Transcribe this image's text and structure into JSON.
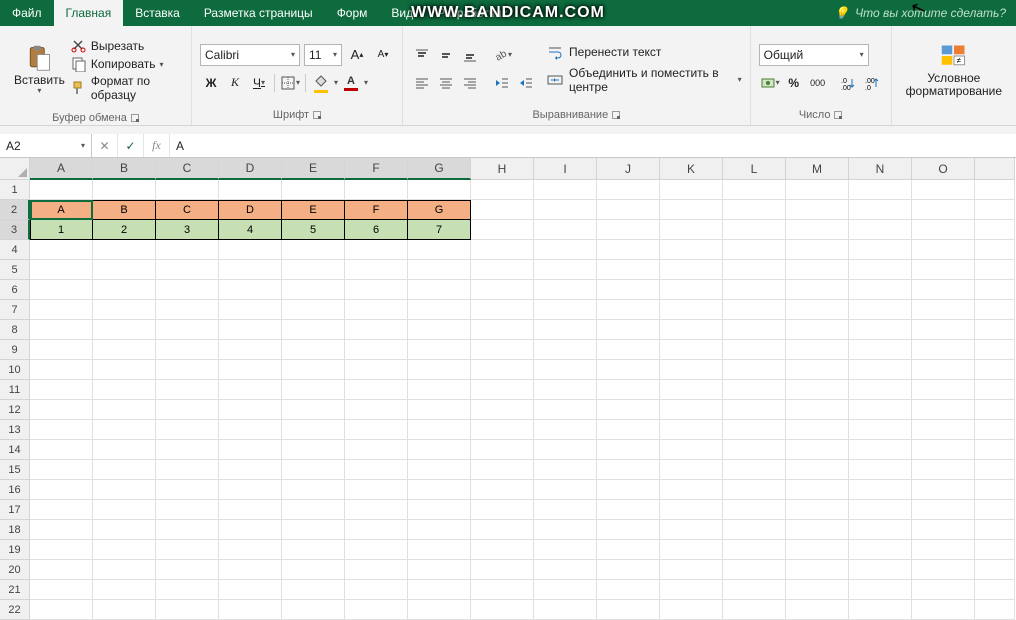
{
  "watermark": "WWW.BANDICAM.COM",
  "tabs": {
    "file": "Файл",
    "home": "Главная",
    "insert": "Вставка",
    "layout": "Разметка страницы",
    "formulas": "Форм",
    "view": "Вид",
    "developer": "Разработчик"
  },
  "tell_me": "Что вы хотите сделать?",
  "clipboard": {
    "paste": "Вставить",
    "cut": "Вырезать",
    "copy": "Копировать",
    "format": "Формат по образцу",
    "group": "Буфер обмена"
  },
  "font": {
    "name": "Calibri",
    "size": "11",
    "bold": "Ж",
    "italic": "К",
    "underline": "Ч",
    "group": "Шрифт",
    "grow": "A",
    "shrink": "A"
  },
  "alignment": {
    "wrap": "Перенести текст",
    "merge": "Объединить и поместить в центре",
    "group": "Выравнивание"
  },
  "number": {
    "format": "Общий",
    "group": "Число",
    "percent": "%",
    "comma": "000"
  },
  "cond": {
    "label": "Условное форматирование"
  },
  "fbar": {
    "ref": "A2",
    "value": "А"
  },
  "cols": [
    "A",
    "B",
    "C",
    "D",
    "E",
    "F",
    "G",
    "H",
    "I",
    "J",
    "K",
    "L",
    "M",
    "N",
    "O"
  ],
  "row2": [
    "А",
    "В",
    "С",
    "D",
    "E",
    "F",
    "G"
  ],
  "row3": [
    "1",
    "2",
    "3",
    "4",
    "5",
    "6",
    "7"
  ],
  "rowcount": 22
}
